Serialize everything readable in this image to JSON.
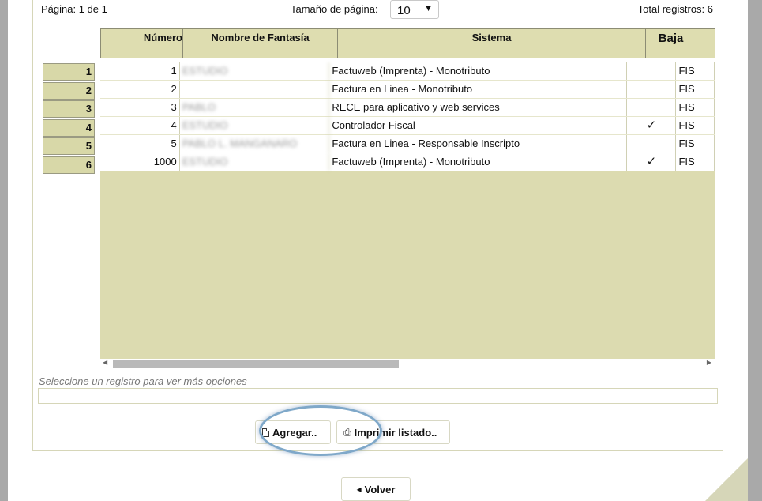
{
  "pagination": {
    "page_info": "Página: 1 de 1",
    "page_size_label": "Tamaño de página:",
    "page_size_value": "10",
    "total_records": "Total registros: 6"
  },
  "grid": {
    "columns": [
      "Número",
      "Nombre de Fantasía",
      "Sistema",
      "Baja",
      ""
    ],
    "rows": [
      {
        "rownum": "1",
        "numero": "1",
        "nombre": "ESTUDIO",
        "sistema": "Factuweb (Imprenta) - Monotributo",
        "baja": "",
        "extra": "FIS"
      },
      {
        "rownum": "2",
        "numero": "2",
        "nombre": "",
        "sistema": "Factura en Linea - Monotributo",
        "baja": "",
        "extra": "FIS"
      },
      {
        "rownum": "3",
        "numero": "3",
        "nombre": "PABLO",
        "sistema": "RECE para aplicativo y web services",
        "baja": "",
        "extra": "FIS"
      },
      {
        "rownum": "4",
        "numero": "4",
        "nombre": "ESTUDIO",
        "sistema": "Controlador Fiscal",
        "baja": "✓",
        "extra": "FIS"
      },
      {
        "rownum": "5",
        "numero": "5",
        "nombre": "PABLO L. MANGANARO",
        "sistema": "Factura en Linea - Responsable Inscripto",
        "baja": "",
        "extra": "FIS"
      },
      {
        "rownum": "6",
        "numero": "1000",
        "nombre": "ESTUDIO",
        "sistema": "Factuweb (Imprenta) - Monotributo",
        "baja": "✓",
        "extra": "FIS"
      }
    ]
  },
  "hint": "Seleccione un registro para ver más opciones",
  "buttons": {
    "add_label": "Agregar..",
    "print_label": "Imprimir listado..",
    "back_label": "Volver"
  },
  "icons": {
    "add": "document-icon",
    "print": "printer-icon",
    "back": "arrow-left-icon"
  },
  "colors": {
    "grid_header": "#deddb0",
    "grid_empty": "#dcdbb0",
    "highlight": "#7fa8c9"
  }
}
